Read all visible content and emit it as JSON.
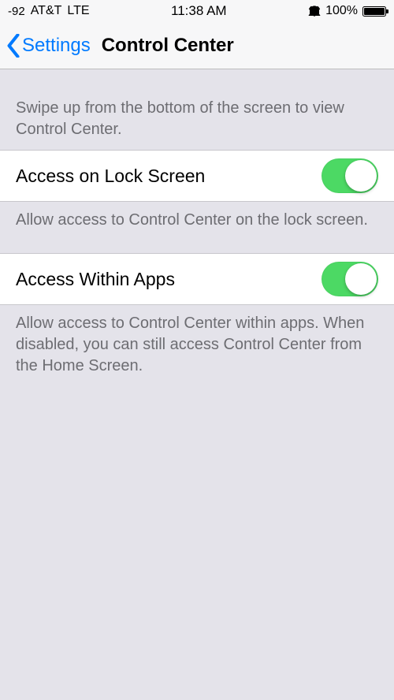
{
  "status": {
    "signal": "-92",
    "carrier": "AT&T",
    "network": "LTE",
    "time": "11:38 AM",
    "battery_percent": "100%"
  },
  "nav": {
    "back_label": "Settings",
    "title": "Control Center"
  },
  "section_intro": "Swipe up from the bottom of the screen to view Control Center.",
  "setting_lock": {
    "label": "Access on Lock Screen",
    "footer": "Allow access to Control Center on the lock screen.",
    "on": true
  },
  "setting_apps": {
    "label": "Access Within Apps",
    "footer": "Allow access to Control Center within apps. When disabled, you can still access Control Center from the Home Screen.",
    "on": true
  }
}
